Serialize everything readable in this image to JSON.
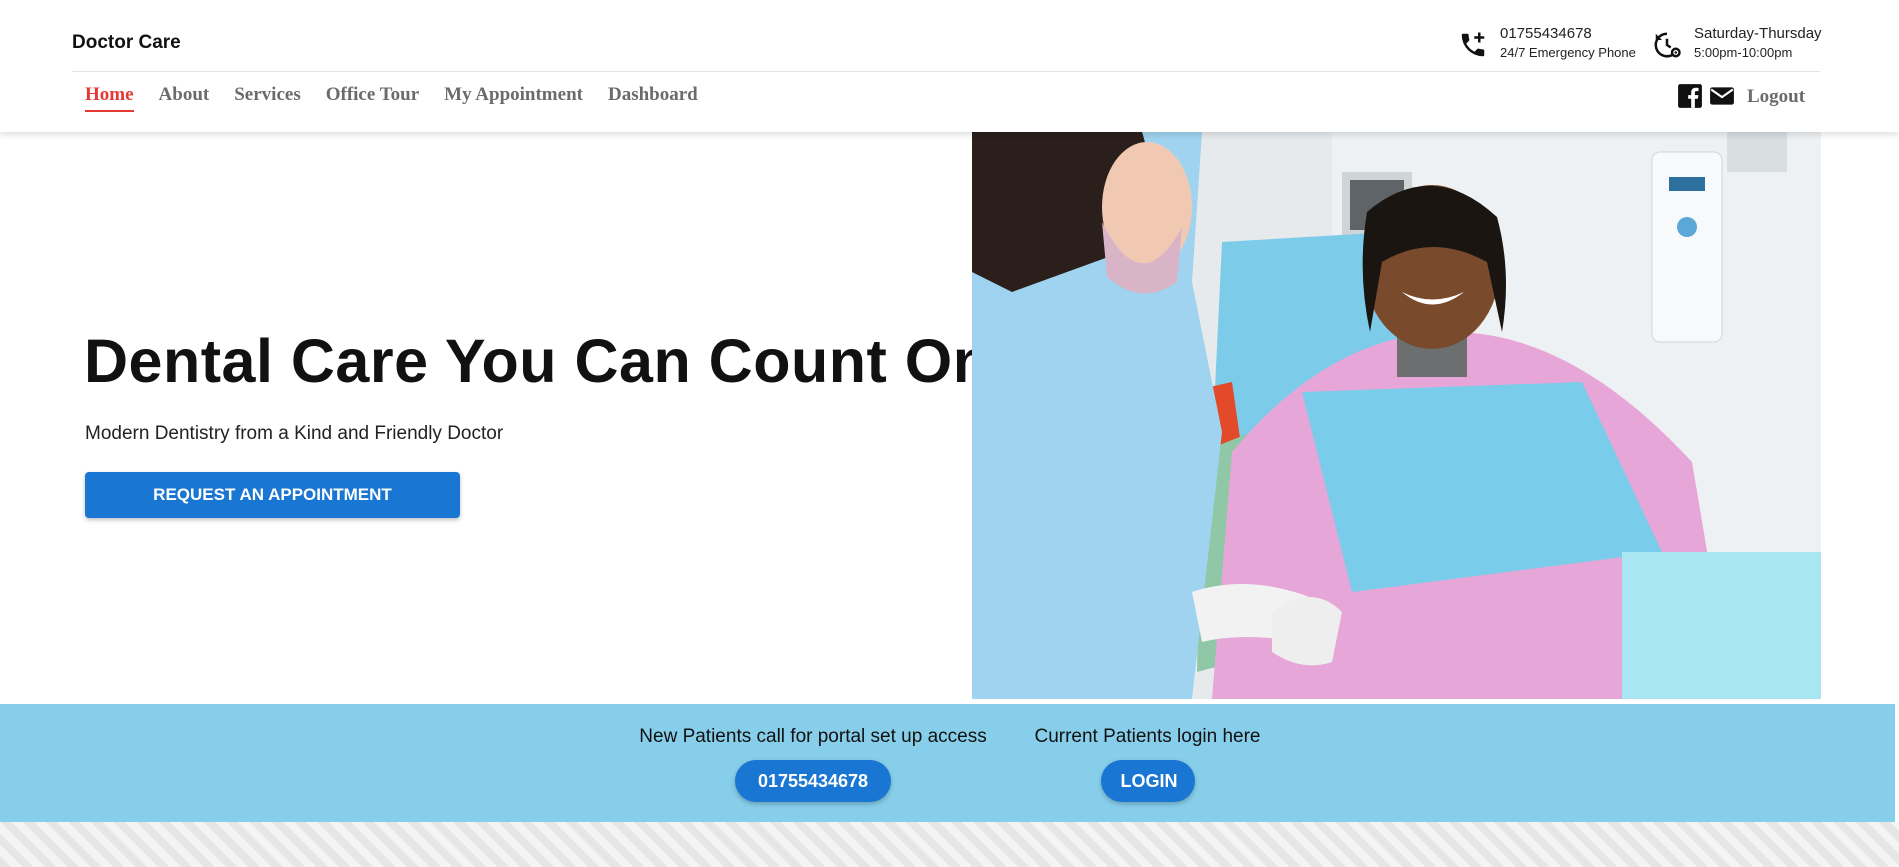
{
  "header": {
    "brand": "Doctor Care",
    "phone": {
      "number": "01755434678",
      "label": "24/7 Emergency Phone",
      "icon": "phone-plus-icon"
    },
    "hours": {
      "days": "Saturday-Thursday",
      "time": "5:00pm-10:00pm",
      "icon": "clock-settings-icon"
    }
  },
  "nav": {
    "items": [
      {
        "label": "Home",
        "active": true
      },
      {
        "label": "About"
      },
      {
        "label": "Services"
      },
      {
        "label": "Office Tour"
      },
      {
        "label": "My Appointment"
      },
      {
        "label": "Dashboard"
      }
    ],
    "social_icons": [
      "facebook-icon",
      "mail-icon"
    ],
    "logout": "Logout"
  },
  "hero": {
    "title": "Dental Care You Can Count On!",
    "subtitle": "Modern Dentistry from a Kind and Friendly Doctor",
    "cta": "REQUEST AN APPOINTMENT"
  },
  "band": {
    "new_patients_text": "New Patients call for portal set up access",
    "new_patients_button": "01755434678",
    "current_patients_text": "Current Patients login here",
    "current_patients_button": "LOGIN"
  },
  "colors": {
    "accent": "#1976d2",
    "active_nav": "#e53935",
    "band": "#87ceeb"
  }
}
